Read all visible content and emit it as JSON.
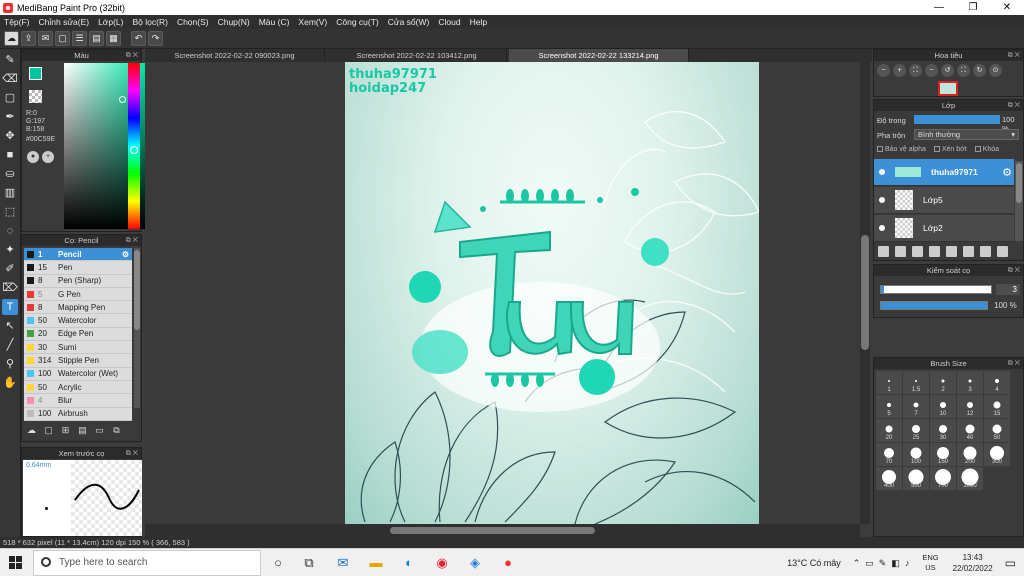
{
  "window": {
    "title": "MediBang Paint Pro (32bit)",
    "controls": [
      "—",
      "❐",
      "✕"
    ]
  },
  "menu": [
    "Tệp(F)",
    "Chỉnh sửa(E)",
    "Lớp(L)",
    "Bộ lọc(R)",
    "Chọn(S)",
    "Chụp(N)",
    "Màu (C)",
    "Xem(V)",
    "Công cụ(T)",
    "Cửa sổ(W)",
    "Cloud",
    "Help"
  ],
  "color_panel": {
    "title": "Màu",
    "r": "R:0",
    "g": "G:197",
    "b": "B:158",
    "hex": "#00C59E",
    "main_color": "#00c59e"
  },
  "brush_panel": {
    "title": "Cọ: Pencil",
    "brushes": [
      {
        "size": "1",
        "name": "Pencil",
        "color": "#1a1a1a",
        "selected": true
      },
      {
        "size": "15",
        "name": "Pen",
        "color": "#1a1a1a"
      },
      {
        "size": "8",
        "name": "Pen (Sharp)",
        "color": "#1a1a1a"
      },
      {
        "size": "5",
        "name": "G Pen",
        "color": "#e53935",
        "dim": true
      },
      {
        "size": "8",
        "name": "Mapping Pen",
        "color": "#e53935"
      },
      {
        "size": "50",
        "name": "Watercolor",
        "color": "#4fc3f7"
      },
      {
        "size": "20",
        "name": "Edge Pen",
        "color": "#43a047"
      },
      {
        "size": "30",
        "name": "Sumi",
        "color": "#fdd835"
      },
      {
        "size": "314",
        "name": "Stipple Pen",
        "color": "#fdd835"
      },
      {
        "size": "100",
        "name": "Watercolor (Wet)",
        "color": "#4fc3f7"
      },
      {
        "size": "50",
        "name": "Acrylic",
        "color": "#fdd835"
      },
      {
        "size": "4",
        "name": "Blur",
        "color": "#f48fb1",
        "dim": true
      },
      {
        "size": "100",
        "name": "Airbrush",
        "color": "#bdbdbd"
      }
    ]
  },
  "preview_panel": {
    "title": "Xem trước cọ",
    "size": "0,64mm"
  },
  "doc_tabs": [
    {
      "label": "Screenshot 2022-02-22 090023.png",
      "active": false
    },
    {
      "label": "Screenshot 2022-02-22 103412.png",
      "active": false
    },
    {
      "label": "Screenshot 2022-02-22 133214.png",
      "active": true
    }
  ],
  "canvas": {
    "watermark_line1": "thuha97971",
    "watermark_line2": "hoidap247"
  },
  "navigator": {
    "title": "Hoa tiêu",
    "icons": [
      "zoom-out",
      "zoom-in",
      "fit",
      "zoom-out-2",
      "rotate-left",
      "fit-width",
      "rotate-right",
      "reset"
    ]
  },
  "layer_panel": {
    "title": "Lớp",
    "opacity_label": "Độ trong",
    "opacity_value": "100 %",
    "blend_label": "Pha trộn",
    "blend_value": "Bình thường",
    "protect_alpha": "Bảo vệ alpha",
    "clipping": "Xén bớt",
    "lock": "Khóa",
    "layers": [
      {
        "name": "thuha97971",
        "selected": true
      },
      {
        "name": "Lớp5",
        "selected": false
      },
      {
        "name": "Lớp2",
        "selected": false
      }
    ]
  },
  "stabilizer": {
    "title": "Kiểm soát cọ",
    "correction": "3",
    "opacity": "100 %"
  },
  "brush_size": {
    "title": "Brush Size",
    "sizes": [
      "1",
      "1.5",
      "2",
      "3",
      "4",
      "5",
      "7",
      "10",
      "12",
      "15",
      "20",
      "25",
      "30",
      "40",
      "50",
      "70",
      "100",
      "150",
      "200",
      "300",
      "400",
      "500",
      "700",
      "1000"
    ]
  },
  "status": {
    "text": "518 * 632 pixel   (11 * 13.4cm)  120 dpi   150 %   ( 366, 583 )"
  },
  "taskbar": {
    "search_placeholder": "Type here to search",
    "weather": "13°C  Có mây",
    "lang_top": "ENG",
    "lang_bottom": "US",
    "time": "13:43",
    "date": "22/02/2022"
  }
}
